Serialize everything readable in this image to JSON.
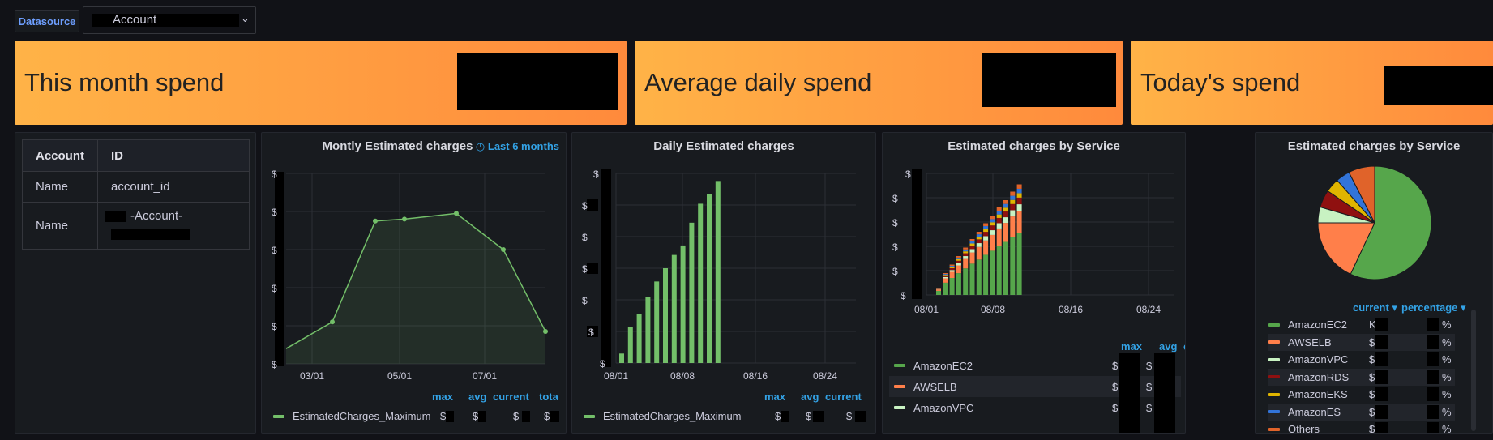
{
  "toolbar": {
    "datasource_label": "Datasource",
    "account_select_value": "Account",
    "chevron_icon": "chevron-down-icon"
  },
  "stats": [
    {
      "title": "This month spend"
    },
    {
      "title": "Average daily spend"
    },
    {
      "title": "Today's spend"
    }
  ],
  "account_table": {
    "headers": [
      "Account",
      "ID"
    ],
    "rows": [
      {
        "label": "Name",
        "value": "account_id"
      },
      {
        "label": "Name",
        "value": "-Account-"
      }
    ]
  },
  "monthly_panel": {
    "title": "Montly Estimated charges",
    "time_range": "Last 6 months",
    "y_tick_label": "$",
    "legend_headers": [
      "max",
      "avg",
      "current",
      "tota"
    ],
    "legend_series": "EstimatedCharges_Maximum",
    "legend_values": [
      "$",
      "$",
      "$",
      "$"
    ],
    "color": "#73bf69"
  },
  "daily_panel": {
    "title": "Daily Estimated charges",
    "y_tick_label": "$",
    "legend_headers": [
      "max",
      "avg",
      "current"
    ],
    "legend_series": "EstimatedCharges_Maximum",
    "legend_values": [
      "$",
      "$",
      "$"
    ],
    "color": "#73bf69"
  },
  "service_panel": {
    "title": "Estimated charges by Service",
    "y_tick_label": "$",
    "legend_headers": [
      "max",
      "avg",
      "current"
    ],
    "legend_rows": [
      {
        "name": "AmazonEC2",
        "color": "#56a64b"
      },
      {
        "name": "AWSELB",
        "color": "#ff7f4a"
      },
      {
        "name": "AmazonVPC",
        "color": "#c8f2c2"
      }
    ],
    "legend_values": [
      "$",
      "$",
      "$"
    ]
  },
  "pie_panel": {
    "title": "Estimated charges by Service",
    "legend_headers": [
      "current",
      "percentage"
    ],
    "rows": [
      {
        "name": "AmazonEC2",
        "color": "#56a64b",
        "current": "K",
        "percentage": "%"
      },
      {
        "name": "AWSELB",
        "color": "#ff7f4a",
        "current": "$",
        "percentage": "%"
      },
      {
        "name": "AmazonVPC",
        "color": "#c8f2c2",
        "current": "$",
        "percentage": "%"
      },
      {
        "name": "AmazonRDS",
        "color": "#8f1010",
        "current": "$",
        "percentage": "%"
      },
      {
        "name": "AmazonEKS",
        "color": "#e0b400",
        "current": "$",
        "percentage": "%"
      },
      {
        "name": "AmazonES",
        "color": "#3274d9",
        "current": "$",
        "percentage": "%"
      },
      {
        "name": "Others",
        "color": "#e0632a",
        "current": "$",
        "percentage": "%"
      }
    ]
  },
  "chart_data": [
    {
      "type": "area",
      "title": "Montly Estimated charges",
      "x": [
        "02/01",
        "03/01",
        "04/01",
        "05/01",
        "06/01",
        "07/01",
        "08/01"
      ],
      "x_tick_labels": [
        "03/01",
        "05/01",
        "07/01"
      ],
      "values": [
        0.08,
        0.22,
        0.75,
        0.76,
        0.79,
        0.6,
        0.17
      ],
      "value_scale": "fraction of redacted y-axis range"
    },
    {
      "type": "bar",
      "title": "Daily Estimated charges",
      "x_tick_labels": [
        "08/01",
        "08/08",
        "08/16",
        "08/24"
      ],
      "values": [
        0.05,
        0.19,
        0.26,
        0.35,
        0.43,
        0.5,
        0.57,
        0.62,
        0.74,
        0.84,
        0.89,
        0.96
      ],
      "value_scale": "fraction of redacted y-axis range"
    },
    {
      "type": "bar",
      "title": "Estimated charges by Service",
      "stacked": true,
      "x_tick_labels": [
        "08/01",
        "08/08",
        "08/16",
        "08/24"
      ],
      "totals": [
        0.06,
        0.18,
        0.25,
        0.32,
        0.39,
        0.46,
        0.52,
        0.59,
        0.65,
        0.72,
        0.78,
        0.85,
        0.91
      ],
      "series_colors": [
        "#56a64b",
        "#ff7f4a",
        "#c8f2c2",
        "#8f1010",
        "#e0b400",
        "#3274d9",
        "#e0632a"
      ],
      "series_shares": [
        0.56,
        0.2,
        0.06,
        0.06,
        0.04,
        0.04,
        0.04
      ],
      "value_scale": "fraction of redacted y-axis range"
    },
    {
      "type": "pie",
      "title": "Estimated charges by Service",
      "labels": [
        "AmazonEC2",
        "AWSELB",
        "AmazonVPC",
        "AmazonRDS",
        "AmazonEKS",
        "AmazonES",
        "Others"
      ],
      "values": [
        57,
        18,
        4.5,
        5,
        4,
        4,
        7.5
      ],
      "colors": [
        "#56a64b",
        "#ff7f4a",
        "#c8f2c2",
        "#8f1010",
        "#e0b400",
        "#3274d9",
        "#e0632a"
      ]
    }
  ]
}
